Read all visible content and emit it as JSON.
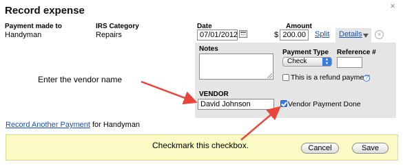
{
  "dialog": {
    "title": "Record expense",
    "payment_made_to_label": "Payment made to",
    "payment_made_to_value": "Handyman",
    "irs_category_label": "IRS Category",
    "irs_category_value": "Repairs",
    "date_label": "Date",
    "date_value": "07/01/2012",
    "amount_label": "Amount",
    "currency_symbol": "$",
    "amount_value": "200.00",
    "split_link": "Split",
    "details_tab": "Details",
    "close_glyph": "×",
    "remove_glyph": "×"
  },
  "details": {
    "notes_label": "Notes",
    "notes_value": "",
    "payment_type_label": "Payment Type",
    "payment_type_value": "Check",
    "reference_label": "Reference #",
    "reference_value": "",
    "refund_label": "This is a refund payment",
    "refund_checked": false,
    "vendor_label": "VENDOR",
    "vendor_value": "David Johnson",
    "vendor_done_label": "Vendor Payment Done",
    "vendor_done_checked": true
  },
  "links": {
    "record_another": "Record Another Payment",
    "record_another_suffix": " for Handyman"
  },
  "footer": {
    "cancel_label": "Cancel",
    "save_label": "Save"
  },
  "annotations": {
    "vendor_callout": "Enter the vendor name",
    "checkbox_callout": "Checkmark this checkbox.",
    "arrow_color": "#e8453c"
  },
  "colors": {
    "panel_bg": "#e5e5e5",
    "footer_bg": "#fbf9c4",
    "link": "#1a4fb5",
    "checkbox_accent": "#3b7ae0"
  },
  "icons": {
    "calendar": "calendar-icon",
    "details_arrow": "chevron-down-icon",
    "help": "help-icon",
    "close": "close-icon"
  }
}
